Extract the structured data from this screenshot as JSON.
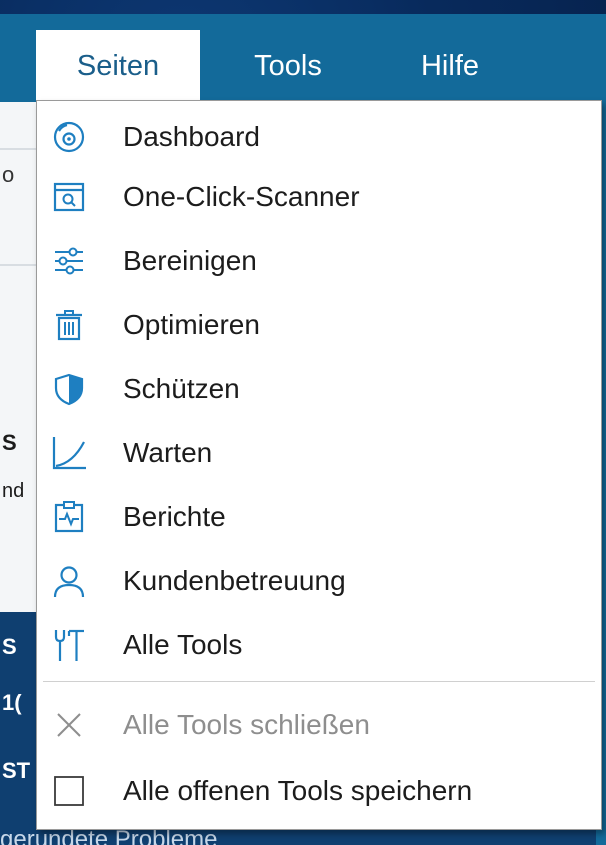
{
  "menubar": {
    "tabs": [
      {
        "label": "Seiten",
        "active": true
      },
      {
        "label": "Tools",
        "active": false
      },
      {
        "label": "Hilfe",
        "active": false
      }
    ]
  },
  "background": {
    "fragments": [
      "o",
      "S",
      "nd",
      "S",
      "1(",
      "ST",
      "gerundete Probleme"
    ]
  },
  "menu": {
    "items": [
      {
        "label": "Dashboard",
        "icon": "dashboard-icon"
      },
      {
        "label": "One-Click-Scanner",
        "icon": "scanner-icon"
      },
      {
        "label": "Bereinigen",
        "icon": "sliders-icon"
      },
      {
        "label": "Optimieren",
        "icon": "trash-icon"
      },
      {
        "label": "Schützen",
        "icon": "shield-icon"
      },
      {
        "label": "Warten",
        "icon": "chart-icon"
      },
      {
        "label": "Berichte",
        "icon": "report-icon"
      },
      {
        "label": "Kundenbetreuung",
        "icon": "user-icon"
      },
      {
        "label": "Alle Tools",
        "icon": "tools-icon"
      }
    ],
    "close_all": {
      "label": "Alle Tools schließen",
      "icon": "close-icon",
      "disabled": true
    },
    "save_all": {
      "label": "Alle offenen Tools speichern",
      "icon": "checkbox",
      "checked": false
    }
  },
  "colors": {
    "accent": "#1e7fc1",
    "menubar": "#136a9a",
    "text": "#1c1c1c",
    "disabled": "#8e8e8e"
  }
}
